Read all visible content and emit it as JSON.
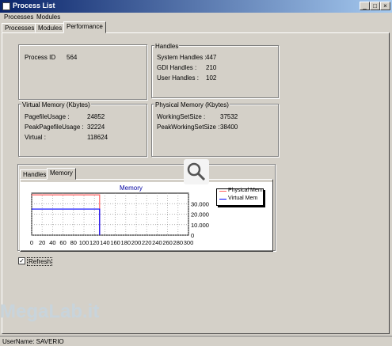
{
  "window": {
    "title": "Process List",
    "minimize": "_",
    "maximize": "□",
    "close": "×"
  },
  "menu": [
    "Processes",
    "Modules"
  ],
  "tabs": [
    {
      "label": "Processes"
    },
    {
      "label": "Modules"
    },
    {
      "label": "Performance"
    }
  ],
  "process": {
    "label": "Process ID",
    "value": "564"
  },
  "handles": {
    "title": "Handles",
    "rows": [
      {
        "label": "System Handles :",
        "value": "447"
      },
      {
        "label": "GDI Handles :",
        "value": "210"
      },
      {
        "label": "User Handles :",
        "value": "102"
      }
    ]
  },
  "virtual_memory": {
    "title": "Virtual Memory (Kbytes)",
    "rows": [
      {
        "label": "PagefileUsage :",
        "value": "24852"
      },
      {
        "label": "PeakPagefileUsage :",
        "value": "32224"
      },
      {
        "label": "Virtual :",
        "value": "118624"
      }
    ]
  },
  "physical_memory": {
    "title": "Physical Memory (Kbytes)",
    "rows": [
      {
        "label": "WorkingSetSize :",
        "value": "37532"
      },
      {
        "label": "PeakWorkingSetSize :",
        "value": "38400"
      }
    ]
  },
  "subtabs": [
    {
      "label": "Handles"
    },
    {
      "label": "Memory"
    }
  ],
  "refresh": {
    "label": "Refresh",
    "checked": true
  },
  "status": {
    "text": "UserName: SAVERIO"
  },
  "watermark": "MegaLab.it",
  "colors": {
    "physical": "#ff6060",
    "virtual": "#0000ff",
    "chart_title": "#0000a0"
  },
  "chart_data": {
    "type": "line",
    "title": "Memory",
    "xlim": [
      0,
      300
    ],
    "ylim": [
      0,
      40000
    ],
    "x_ticks": [
      "0",
      "20",
      "40",
      "60",
      "80",
      "100",
      "120",
      "140",
      "160",
      "180",
      "200",
      "220",
      "240",
      "260",
      "280",
      "300"
    ],
    "y_ticks": [
      "0",
      "10.000",
      "20.000",
      "30.000"
    ],
    "legend_position": "top-right",
    "series": [
      {
        "name": "Physical Mem",
        "x": [
          0,
          130,
          130
        ],
        "y": [
          38400,
          38400,
          0
        ]
      },
      {
        "name": "Virtual Mem",
        "x": [
          0,
          130,
          130
        ],
        "y": [
          24852,
          24852,
          0
        ]
      }
    ]
  }
}
